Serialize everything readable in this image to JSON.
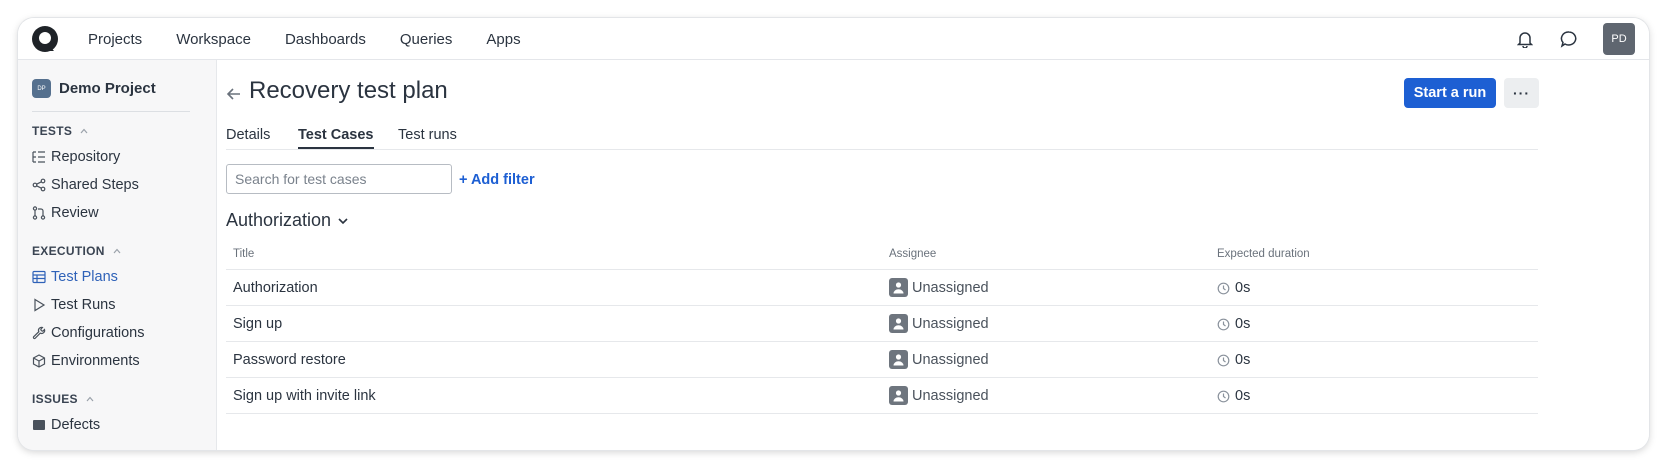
{
  "nav": {
    "items": [
      "Projects",
      "Workspace",
      "Dashboards",
      "Queries",
      "Apps"
    ],
    "avatar_initials": "PD",
    "icons": [
      "bell-icon",
      "chat-icon"
    ]
  },
  "sidebar": {
    "project_badge": "DP",
    "project_name": "Demo Project",
    "sections": {
      "tests": "TESTS",
      "execution": "EXECUTION",
      "issues": "ISSUES"
    },
    "items": {
      "repository": "Repository",
      "shared_steps": "Shared Steps",
      "review": "Review",
      "test_plans": "Test Plans",
      "test_runs": "Test Runs",
      "configurations": "Configurations",
      "environments": "Environments",
      "defects": "Defects"
    }
  },
  "page": {
    "title": "Recovery test plan",
    "start_button": "Start a run",
    "more_button": "···",
    "tabs": [
      "Details",
      "Test Cases",
      "Test runs"
    ],
    "active_tab": "Test Cases",
    "search_placeholder": "Search for test cases",
    "add_filter": "+ Add filter",
    "group_name": "Authorization"
  },
  "table": {
    "headers": [
      "Title",
      "Assignee",
      "Expected duration"
    ],
    "rows": [
      {
        "title": "Authorization",
        "assignee": "Unassigned",
        "duration": "0s"
      },
      {
        "title": "Sign up",
        "assignee": "Unassigned",
        "duration": "0s"
      },
      {
        "title": "Password restore",
        "assignee": "Unassigned",
        "duration": "0s"
      },
      {
        "title": "Sign up with invite link",
        "assignee": "Unassigned",
        "duration": "0s"
      }
    ]
  },
  "colors": {
    "accent": "#1d5fd3",
    "active_sidebar": "#2f62b8",
    "sidebar_bg": "#f7f7f8"
  }
}
